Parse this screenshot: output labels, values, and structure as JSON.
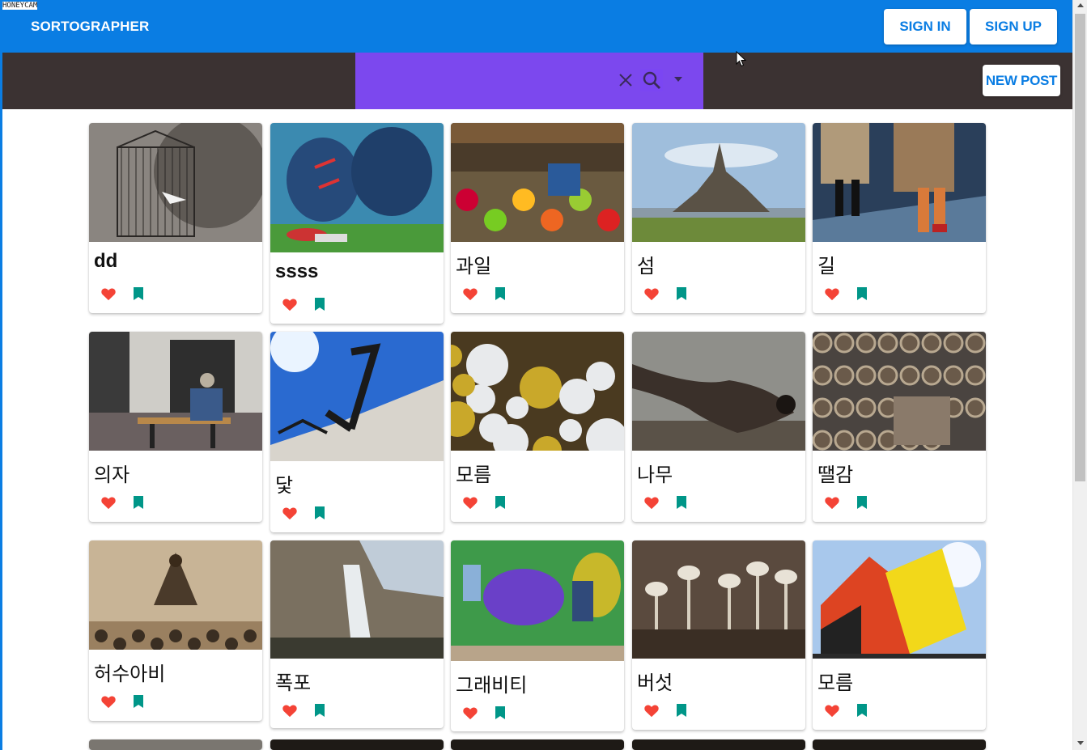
{
  "watermark": "HONEYCAM",
  "header": {
    "brand": "SORTOGRAPHER",
    "sign_in": "SIGN IN",
    "sign_up": "SIGN UP",
    "bg_color": "#0a7de3"
  },
  "toolbar": {
    "search_value": "",
    "clear_icon": "close-icon",
    "search_icon": "search-icon",
    "dropdown_icon": "dropdown-arrow-icon",
    "new_post": "NEW POST",
    "search_bg": "#7c48ee",
    "bar_bg": "#3b3232"
  },
  "posts": [
    {
      "title": "dd",
      "image": "bird-cage",
      "bold": true
    },
    {
      "title": "ssss",
      "image": "hot-air-balloons",
      "bold": true
    },
    {
      "title": "과일",
      "image": "fruit-market"
    },
    {
      "title": "섬",
      "image": "island-abbey"
    },
    {
      "title": "길",
      "image": "wet-street-walkers"
    },
    {
      "title": "의자",
      "image": "man-on-bench"
    },
    {
      "title": "닻",
      "image": "anchors-in-sand"
    },
    {
      "title": "모름",
      "image": "frost-crystals"
    },
    {
      "title": "나무",
      "image": "twisted-tree"
    },
    {
      "title": "땔감",
      "image": "wood-pipes-pile"
    },
    {
      "title": "허수아비",
      "image": "scarecrow-crowd"
    },
    {
      "title": "폭포",
      "image": "waterfall-cliff"
    },
    {
      "title": "그래비티",
      "image": "graffiti-wall"
    },
    {
      "title": "버섯",
      "image": "mushrooms"
    },
    {
      "title": "모름",
      "image": "colorful-glass-building"
    }
  ],
  "colors": {
    "like": "#f44336",
    "bookmark": "#009688",
    "accent": "#0a7de3"
  }
}
